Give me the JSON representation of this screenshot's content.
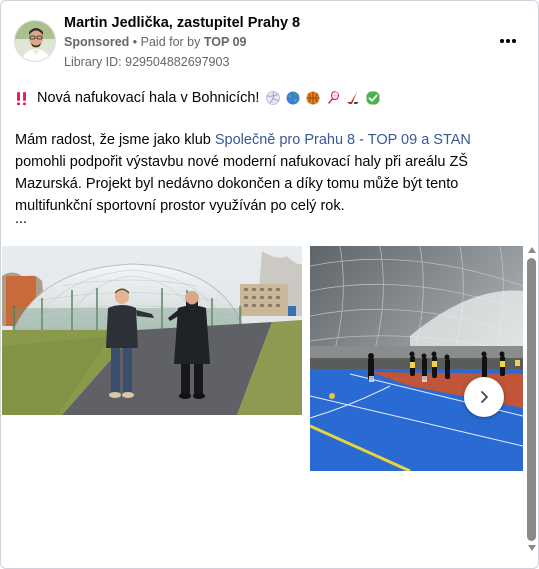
{
  "post": {
    "author_name": "Martin Jedlička, zastupitel Prahy 8",
    "sponsored_label": "Sponsored",
    "separator": " • ",
    "paid_for_prefix": "Paid for by ",
    "paid_for_by": "TOP 09",
    "library_id": "Library ID: 929504882697903",
    "headline_prefix": "‼️",
    "headline": "Nová nafukovací hala v Bohnicích!",
    "headline_emojis": [
      "volleyball-emoji",
      "globe-emoji",
      "basketball-emoji",
      "badminton-emoji",
      "hockey-emoji",
      "check-mark-emoji"
    ],
    "body_part1": "Mám radost, že jsme jako klub ",
    "body_link": "Společně pro Prahu 8 - TOP 09 a STAN",
    "body_part2": " pomohli podpořit výstavbu nové moderní nafukovací haly při areálu ZŠ Mazurská. Projekt byl nedávno dokončen a díky tomu může být tento multifunkční sportovní prostor využíván po celý rok.",
    "ellipsis": "..."
  },
  "colors": {
    "link": "#385898",
    "secondary_text": "#65676b",
    "scrollbar": "#8a8a8a"
  },
  "icons": {
    "more": "more-options-icon",
    "next": "chevron-right-icon"
  }
}
